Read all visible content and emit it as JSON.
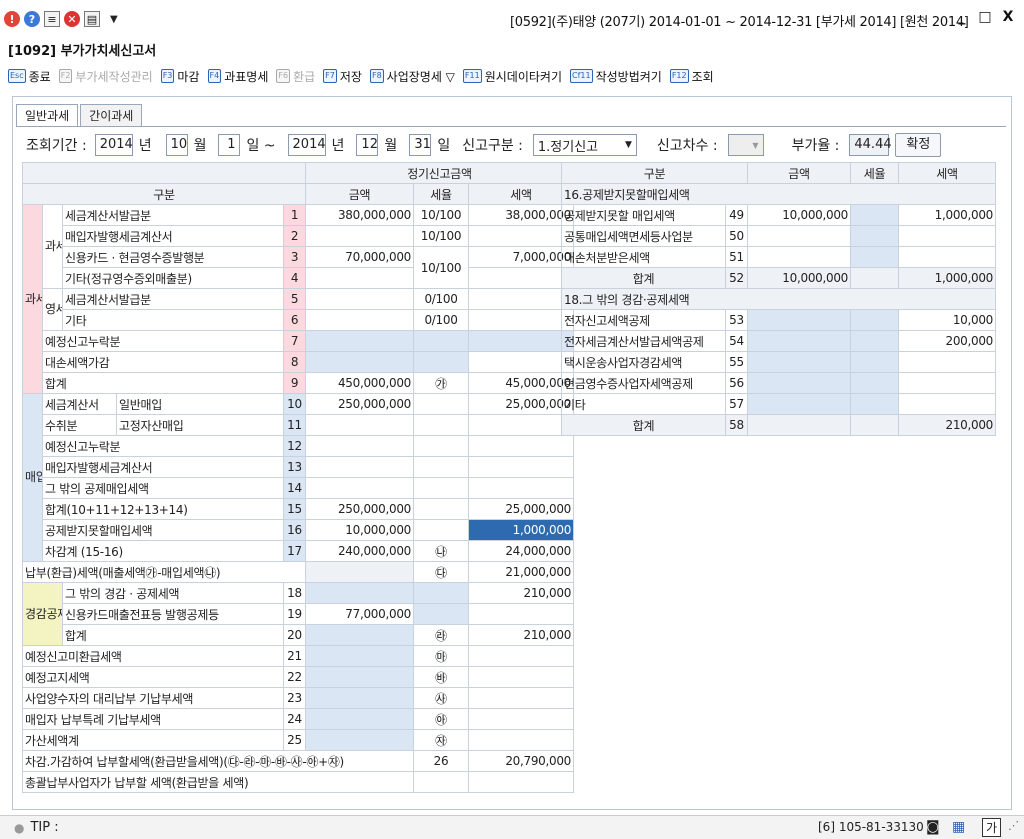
{
  "window": {
    "title": "[0592](주)태양 (207기) 2014-01-01 ~ 2014-12-31 [부가세 2014] [원천 2014]",
    "min_label": "_",
    "max_label": "□",
    "close_label": "X"
  },
  "form_title": "[1092] 부가가치세신고서",
  "toolbar": [
    {
      "key": "Esc",
      "label": "종료",
      "enabled": true
    },
    {
      "key": "F2",
      "label": "부가세작성관리",
      "enabled": false
    },
    {
      "key": "F3",
      "label": "마감",
      "enabled": true
    },
    {
      "key": "F4",
      "label": "과표명세",
      "enabled": true
    },
    {
      "key": "F6",
      "label": "환급",
      "enabled": false
    },
    {
      "key": "F7",
      "label": "저장",
      "enabled": true
    },
    {
      "key": "F8",
      "label": "사업장명세 ▽",
      "enabled": true
    },
    {
      "key": "F11",
      "label": "원시데이타켜기",
      "enabled": true
    },
    {
      "key": "Cf11",
      "label": "작성방법켜기",
      "enabled": true
    },
    {
      "key": "F12",
      "label": "조회",
      "enabled": true
    }
  ],
  "tabs": [
    "일반과세",
    "간이과세"
  ],
  "query": {
    "period_label": "조회기간 :",
    "from_year": "2014",
    "year_unit": "년",
    "from_month": "10",
    "month_unit": "월",
    "from_day": "1",
    "day_unit": "일 ~",
    "to_year": "2014",
    "to_month": "12",
    "to_day": "31",
    "to_day_unit": "일",
    "report_type_label": "신고구분 :",
    "report_type_value": "1.정기신고",
    "report_seq_label": "신고차수 :",
    "report_seq_value": "",
    "rate_label": "부가율 :",
    "rate_value": "44.44",
    "confirm_button": "확정"
  },
  "left": {
    "header_top": "정기신고금액",
    "h_category": "구분",
    "h_amount": "금액",
    "h_rate": "세율",
    "h_tax": "세액",
    "group_sales": "과세표준및매출세액",
    "group_purchase": "매입세액",
    "sub_taxable": "과세",
    "sub_zero": "영세",
    "group_reduction": "경감공제세액",
    "rows": {
      "r1": {
        "label": "세금계산서발급분",
        "no": "1",
        "amount": "380,000,000",
        "rate": "10/100",
        "tax": "38,000,000"
      },
      "r2": {
        "label": "매입자발행세금계산서",
        "no": "2",
        "amount": "",
        "rate": "10/100",
        "tax": ""
      },
      "r3": {
        "label": "신용카드 · 현금영수증발행분",
        "no": "3",
        "amount": "70,000,000",
        "rate": "10/100",
        "tax": "7,000,000"
      },
      "r4": {
        "label": "기타(정규영수증외매출분)",
        "no": "4",
        "amount": ""
      },
      "r5": {
        "label": "세금계산서발급분",
        "no": "5",
        "amount": "",
        "rate": "0/100",
        "tax": ""
      },
      "r6": {
        "label": "기타",
        "no": "6",
        "amount": "",
        "rate": "0/100",
        "tax": ""
      },
      "r7": {
        "label": "예정신고누락분",
        "no": "7"
      },
      "r8": {
        "label": "대손세액가감",
        "no": "8"
      },
      "r9": {
        "label": "합계",
        "no": "9",
        "amount": "450,000,000",
        "rate": "㉮",
        "tax": "45,000,000"
      },
      "r10": {
        "label_a": "세금계산서",
        "label_b": "일반매입",
        "no": "10",
        "amount": "250,000,000",
        "tax": "25,000,000"
      },
      "r11": {
        "label_a": "수취분",
        "label_b": "고정자산매입",
        "no": "11"
      },
      "r12": {
        "label": "예정신고누락분",
        "no": "12"
      },
      "r13": {
        "label": "매입자발행세금계산서",
        "no": "13"
      },
      "r14": {
        "label": "그 밖의 공제매입세액",
        "no": "14"
      },
      "r15": {
        "label": "합계(10+11+12+13+14)",
        "no": "15",
        "amount": "250,000,000",
        "tax": "25,000,000"
      },
      "r16": {
        "label": "공제받지못할매입세액",
        "no": "16",
        "amount": "10,000,000",
        "tax": "1,000,000"
      },
      "r17": {
        "label": "차감계 (15-16)",
        "no": "17",
        "amount": "240,000,000",
        "rate": "㉯",
        "tax": "24,000,000"
      },
      "payable": {
        "label": "납부(환급)세액(매출세액㉮-매입세액㉯)",
        "rate": "㉰",
        "tax": "21,000,000"
      },
      "r18": {
        "label": "그 밖의 경감 · 공제세액",
        "no": "18",
        "tax": "210,000"
      },
      "r19": {
        "label": "신용카드매출전표등 발행공제등",
        "no": "19",
        "amount": "77,000,000"
      },
      "r20": {
        "label": "합계",
        "no": "20",
        "rate": "㉱",
        "tax": "210,000"
      },
      "r21": {
        "label": "예정신고미환급세액",
        "no": "21",
        "rate": "㉲"
      },
      "r22": {
        "label": "예정고지세액",
        "no": "22",
        "rate": "㉳"
      },
      "r23": {
        "label": "사업양수자의 대리납부 기납부세액",
        "no": "23",
        "rate": "㉴"
      },
      "r24": {
        "label": "매입자 납부특례 기납부세액",
        "no": "24",
        "rate": "㉵"
      },
      "r25": {
        "label": "가산세액계",
        "no": "25",
        "rate": "㉶"
      },
      "r26": {
        "label": "차감.가감하여 납부할세액(환급받을세액)(㉰-㉱-㉲-㉳-㉴-㉵+㉶)",
        "no": "26",
        "tax": "20,790,000"
      },
      "r27": {
        "label": "총괄납부사업자가 납부할 세액(환급받을 세액)"
      }
    }
  },
  "right": {
    "h_category": "구분",
    "h_amount": "금액",
    "h_rate": "세율",
    "h_tax": "세액",
    "sec16": "16.공제받지못할매입세액",
    "r49": {
      "label": "공제받지못할 매입세액",
      "no": "49",
      "amount": "10,000,000",
      "tax": "1,000,000"
    },
    "r50": {
      "label": "공통매입세액면세등사업분",
      "no": "50"
    },
    "r51": {
      "label": "대손처분받은세액",
      "no": "51"
    },
    "r52": {
      "label": "합계",
      "no": "52",
      "amount": "10,000,000",
      "tax": "1,000,000"
    },
    "sec18": "18.그 밖의 경감·공제세액",
    "r53": {
      "label": "전자신고세액공제",
      "no": "53",
      "tax": "10,000"
    },
    "r54": {
      "label": "전자세금계산서발급세액공제",
      "no": "54",
      "tax": "200,000"
    },
    "r55": {
      "label": "택시운송사업자경감세액",
      "no": "55"
    },
    "r56": {
      "label": "현금영수증사업자세액공제",
      "no": "56"
    },
    "r57": {
      "label": "기타",
      "no": "57"
    },
    "r58": {
      "label": "합계",
      "no": "58",
      "tax": "210,000"
    }
  },
  "status": {
    "tip_label": "TIP :",
    "company_info": "[6] 105-81-33130",
    "lang_indicator": "가"
  }
}
